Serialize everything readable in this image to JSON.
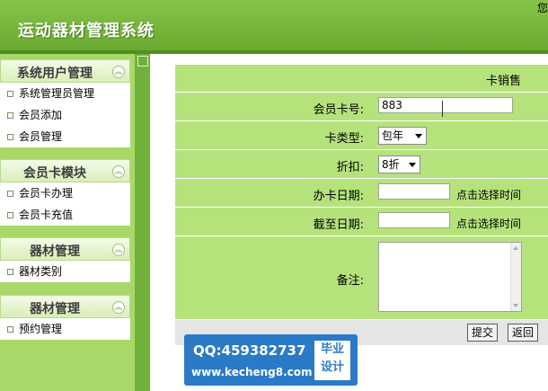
{
  "header": {
    "title": "运动器材管理系统",
    "greeting": "您"
  },
  "sidebar": {
    "sections": [
      {
        "title": "系统用户管理",
        "items": [
          "系统管理员管理",
          "会员添加",
          "会员管理"
        ]
      },
      {
        "title": "会员卡模块",
        "items": [
          "会员卡办理",
          "会员卡充值"
        ]
      },
      {
        "title": "器材管理",
        "items": [
          "器材类别"
        ]
      },
      {
        "title": "器材管理",
        "items": [
          "预约管理"
        ]
      }
    ],
    "collapse_icon": "double-chevron-up-icon"
  },
  "form": {
    "caption": "卡销售",
    "card_no_label": "会员卡号:",
    "card_no_value": "883",
    "card_type_label": "卡类型:",
    "card_type_value": "包年",
    "discount_label": "折扣:",
    "discount_value": "8折",
    "open_date_label": "办卡日期:",
    "open_date_value": "",
    "open_date_hint": "点击选择时间",
    "end_date_label": "截至日期:",
    "end_date_value": "",
    "end_date_hint": "点击选择时间",
    "remark_label": "备注:",
    "remark_value": "",
    "submit_label": "提交",
    "back_label": "返回"
  },
  "watermark": {
    "qq": "QQ:459382737",
    "site": "www.kecheng8.com",
    "badge_line1": "毕业",
    "badge_line2": "设计"
  },
  "colors": {
    "header": "#7bbb3f",
    "form_row": "#b6e27c",
    "sidebar": "#a8d86a",
    "watermark": "#2a7ac7"
  }
}
